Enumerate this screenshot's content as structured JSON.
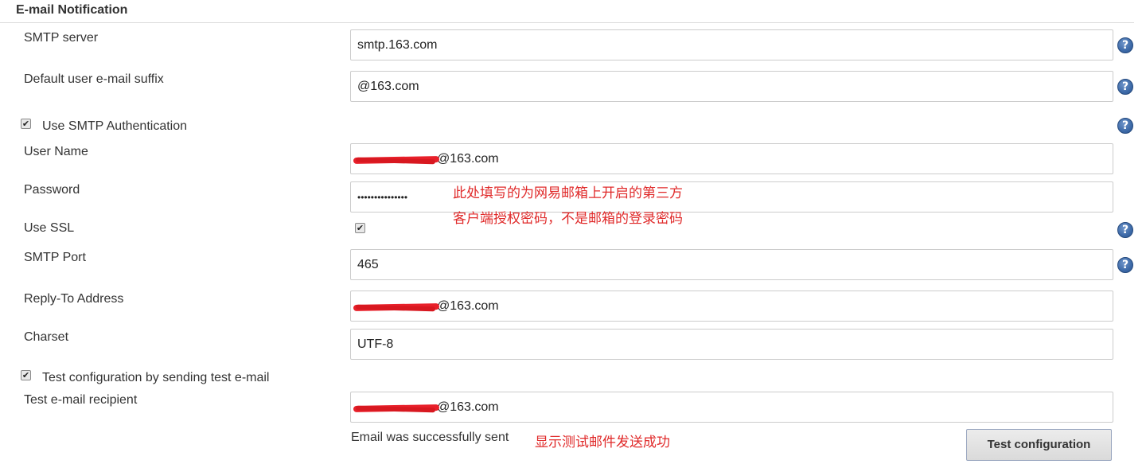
{
  "section": {
    "title": "E-mail Notification"
  },
  "smtp_server": {
    "label": "SMTP server",
    "value": "smtp.163.com"
  },
  "default_suffix": {
    "label": "Default user e-mail suffix",
    "value": "@163.com"
  },
  "use_smtp_auth": {
    "label": "Use SMTP Authentication",
    "checked": true
  },
  "user_name": {
    "label": "User Name",
    "value": "@163.com"
  },
  "password": {
    "label": "Password",
    "value": "•••••••••••••••"
  },
  "annotation_password": {
    "line1": "此处填写的为网易邮箱上开启的第三方",
    "line2": "客户端授权密码，不是邮箱的登录密码"
  },
  "use_ssl": {
    "label": "Use SSL",
    "checked": true
  },
  "smtp_port": {
    "label": "SMTP Port",
    "value": "465"
  },
  "reply_to": {
    "label": "Reply-To Address",
    "value": "@163.com"
  },
  "charset": {
    "label": "Charset",
    "value": "UTF-8"
  },
  "test_config": {
    "label": "Test configuration by sending test e-mail",
    "checked": true
  },
  "test_recipient": {
    "label": "Test e-mail recipient",
    "value": "@163.com"
  },
  "status": {
    "text": "Email was successfully sent"
  },
  "annotation_status": {
    "text": "显示测试邮件发送成功"
  },
  "test_button": {
    "label": "Test configuration"
  },
  "help_icon": {
    "glyph": "?"
  },
  "colors": {
    "annotation": "#e02a2a",
    "help_icon": "#3d6aa8",
    "redaction": "#e8202a"
  }
}
